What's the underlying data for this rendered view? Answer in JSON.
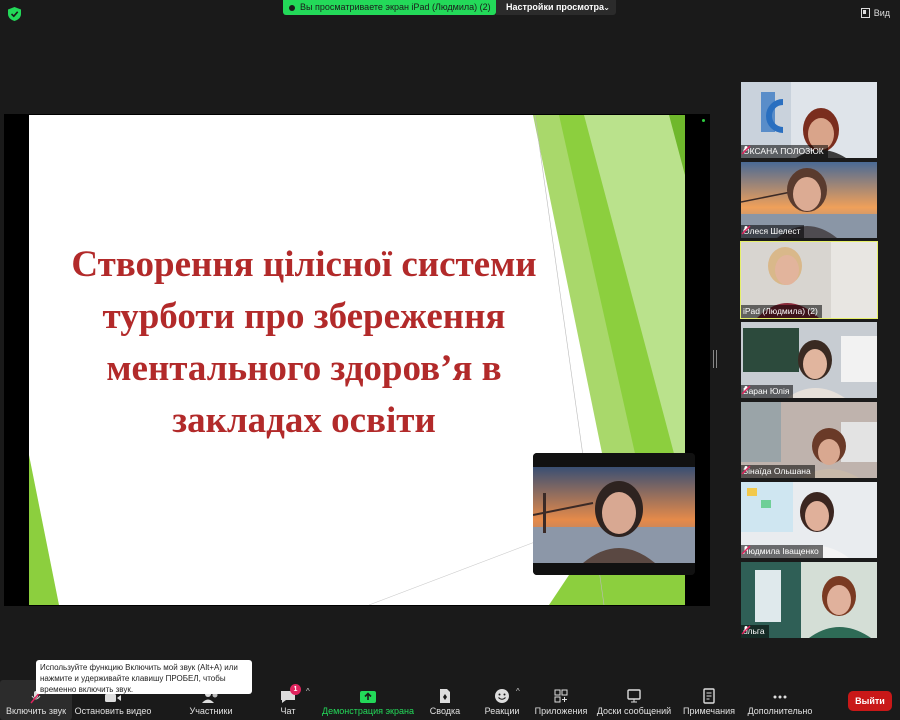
{
  "top_bar": {
    "share_status": "Вы просматриваете экран iPad (Людмила) (2)",
    "view_settings": "Настройки просмотра",
    "view_button": "Вид"
  },
  "slide": {
    "title": "Створення цілісної системи турботи про збереження ментального здоров’я в закладах освіти",
    "title_color": "#b22a2a",
    "accent_color": "#8ccf3e"
  },
  "participants": [
    {
      "name": "ОКСАНА ПОЛОЗЮК",
      "muted": true
    },
    {
      "name": "Олеся Шелест",
      "muted": true
    },
    {
      "name": "iPad (Людмила) (2)",
      "muted": false,
      "active": true
    },
    {
      "name": "Баран Юлія",
      "muted": true
    },
    {
      "name": "Зінаїда Ольшана",
      "muted": true
    },
    {
      "name": "Людмила Іващенко",
      "muted": true
    },
    {
      "name": "ольга",
      "muted": true
    }
  ],
  "tooltip": "Используйте функцию Включить мой звук (Alt+A) или нажмите и удерживайте клавишу ПРОБЕЛ, чтобы временно включить звук.",
  "toolbar": {
    "audio": "Включить звук",
    "video": "Остановить видео",
    "participants": "Участники",
    "chat": "Чат",
    "chat_badge": "1",
    "share": "Демонстрация экрана",
    "summary": "Сводка",
    "reactions": "Реакции",
    "apps": "Приложения",
    "whiteboards": "Доски сообщений",
    "notes": "Примечания",
    "more": "Дополнительно",
    "leave": "Выйти"
  },
  "colors": {
    "share_green": "#23d959",
    "leave_red": "#c91818",
    "active_speaker": "#e6f06a"
  }
}
